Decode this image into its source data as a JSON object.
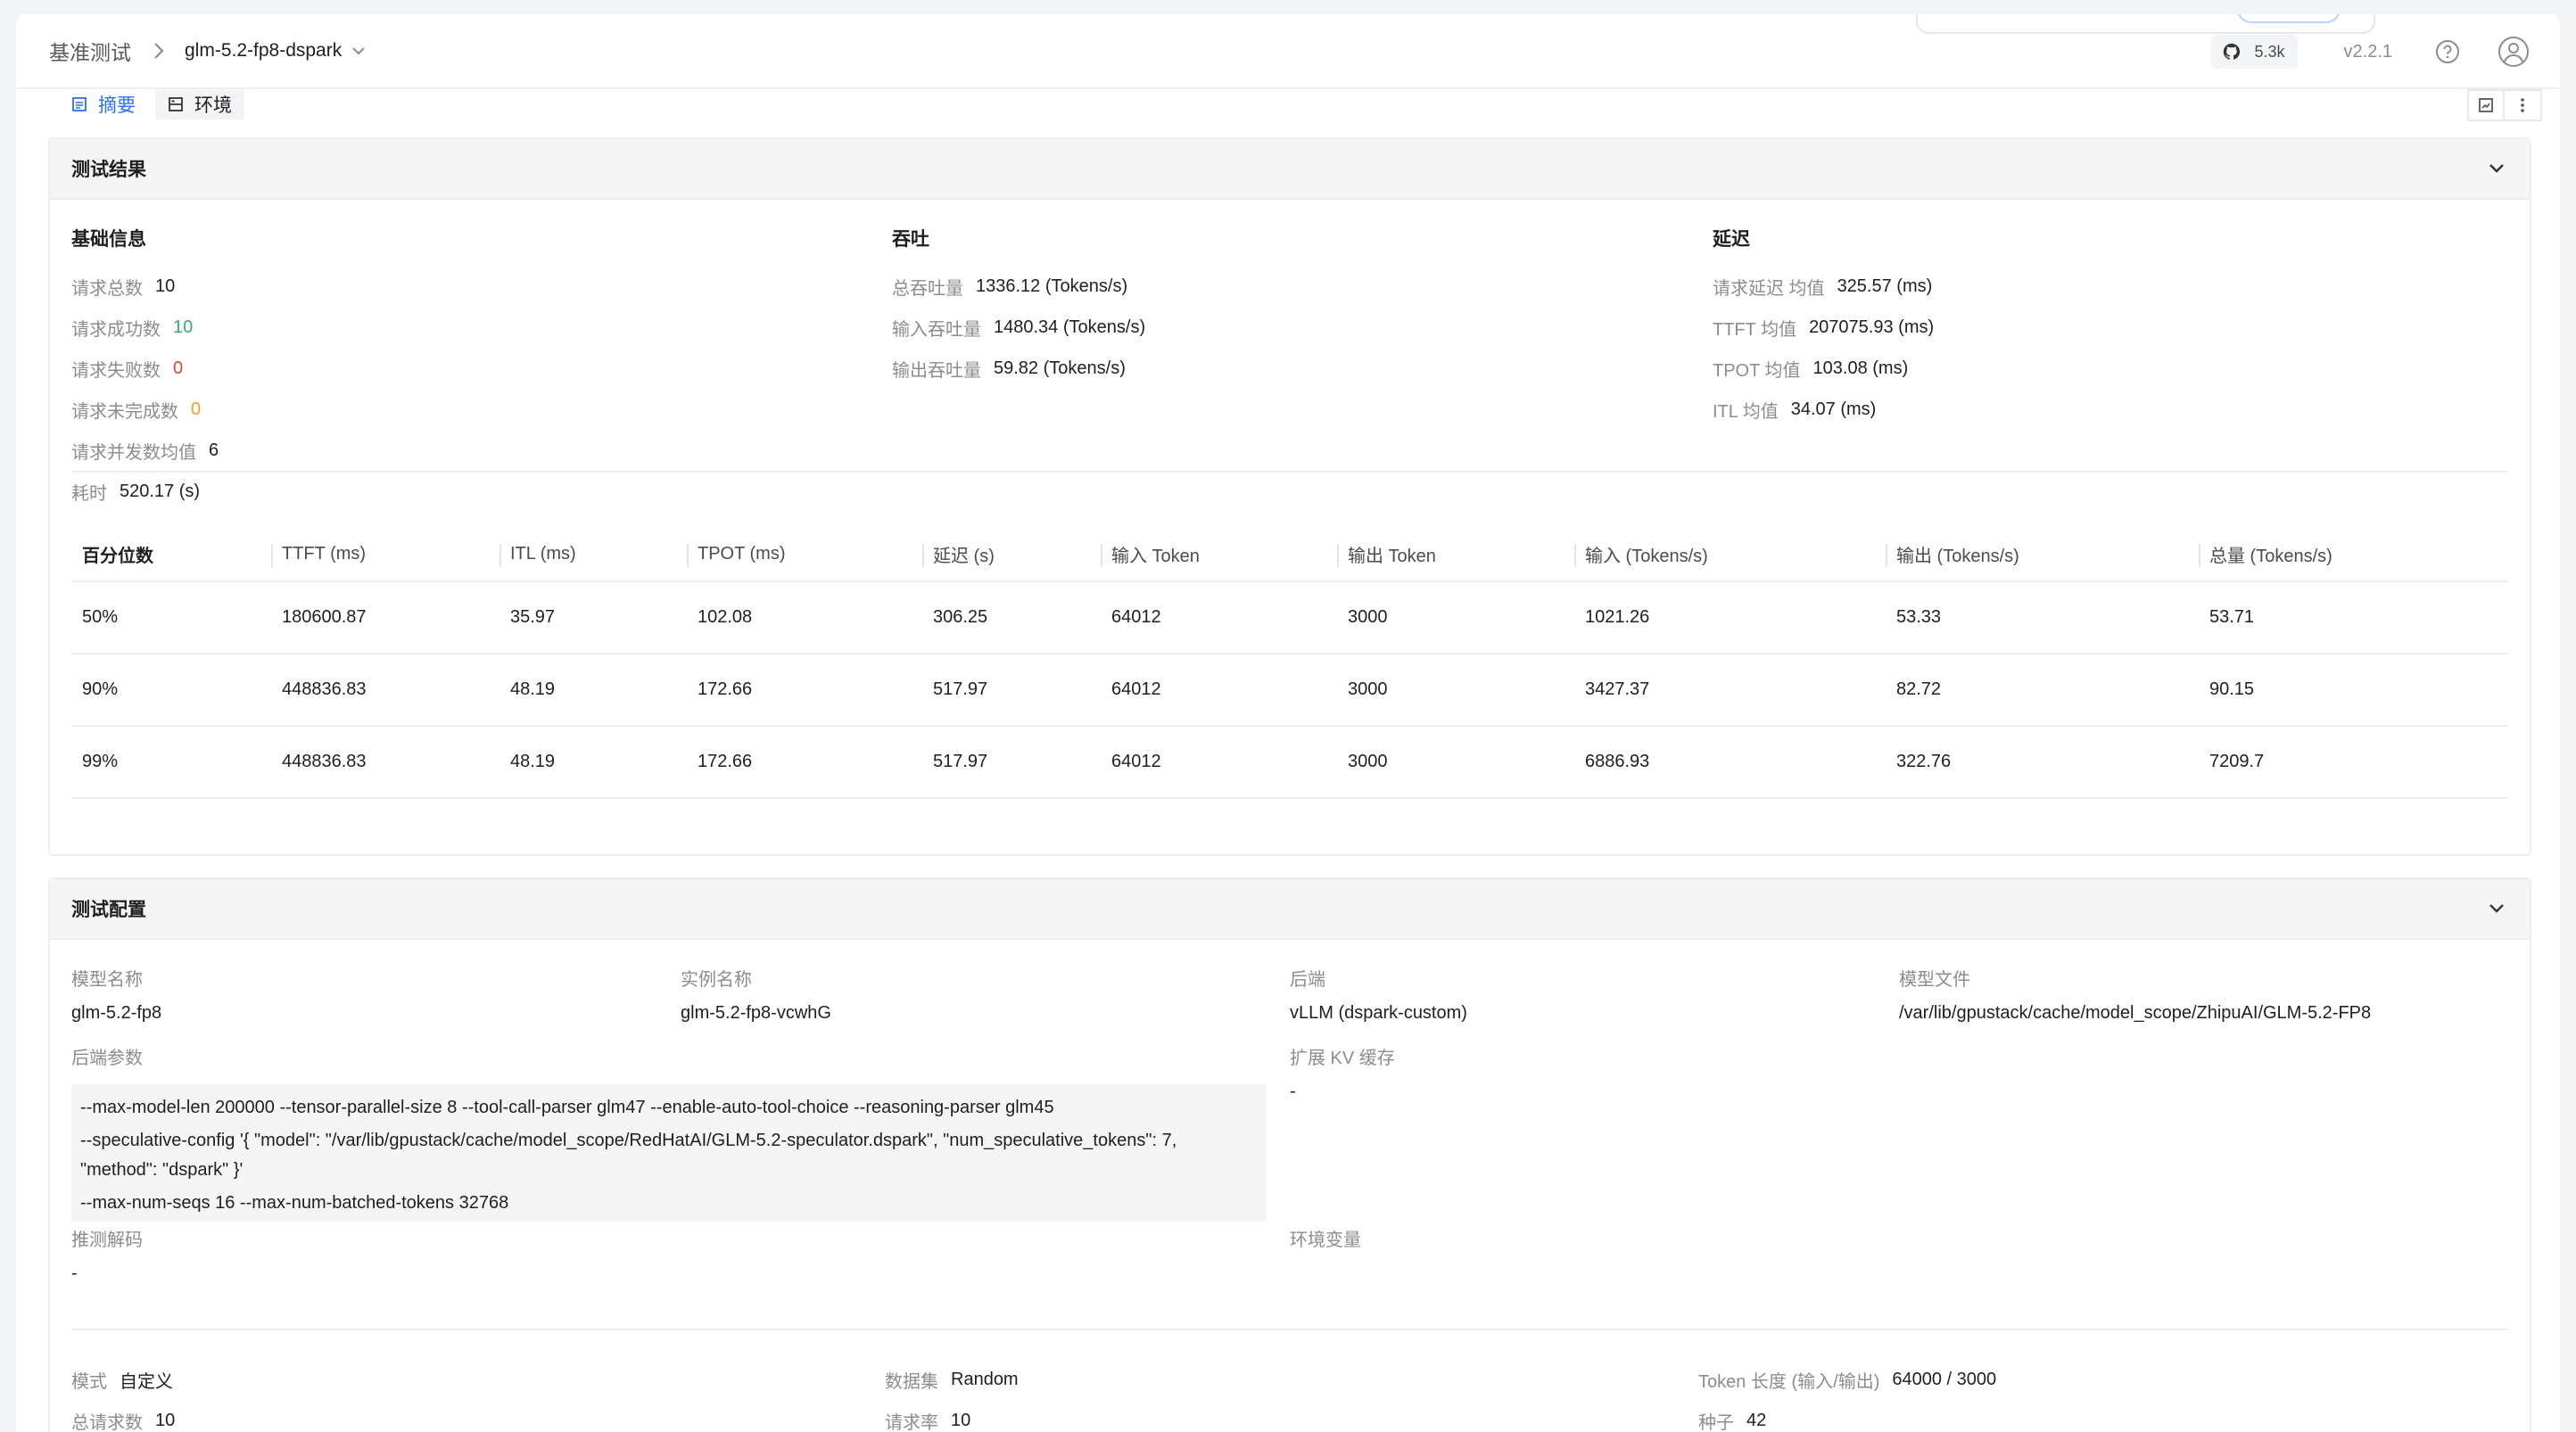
{
  "header": {
    "breadcrumb_root": "基准测试",
    "breadcrumb_current": "glm-5.2-fp8-dspark",
    "github_stars": "5.3k",
    "version": "v2.2.1"
  },
  "tabs": [
    {
      "label": "摘要",
      "active": true
    },
    {
      "label": "环境",
      "active": false
    }
  ],
  "results": {
    "title": "测试结果",
    "basic": {
      "title": "基础信息",
      "items": [
        {
          "label": "请求总数",
          "value": "10"
        },
        {
          "label": "请求成功数",
          "value": "10"
        },
        {
          "label": "请求失败数",
          "value": "0"
        },
        {
          "label": "请求未完成数",
          "value": "0"
        },
        {
          "label": "请求并发数均值",
          "value": "6"
        },
        {
          "label": "耗时",
          "value": "520.17 (s)"
        }
      ]
    },
    "throughput": {
      "title": "吞吐",
      "items": [
        {
          "label": "总吞吐量",
          "value": "1336.12 (Tokens/s)"
        },
        {
          "label": "输入吞吐量",
          "value": "1480.34 (Tokens/s)"
        },
        {
          "label": "输出吞吐量",
          "value": "59.82 (Tokens/s)"
        }
      ]
    },
    "latency": {
      "title": "延迟",
      "items": [
        {
          "label": "请求延迟 均值",
          "value": "325.57 (ms)"
        },
        {
          "label": "TTFT 均值",
          "value": "207075.93 (ms)"
        },
        {
          "label": "TPOT 均值",
          "value": "103.08 (ms)"
        },
        {
          "label": "ITL 均值",
          "value": "34.07 (ms)"
        }
      ]
    },
    "table": {
      "headers": [
        "百分位数",
        "TTFT (ms)",
        "ITL (ms)",
        "TPOT (ms)",
        "延迟 (s)",
        "输入 Token",
        "输出 Token",
        "输入 (Tokens/s)",
        "输出 (Tokens/s)",
        "总量 (Tokens/s)"
      ],
      "rows": [
        [
          "50%",
          "180600.87",
          "35.97",
          "102.08",
          "306.25",
          "64012",
          "3000",
          "1021.26",
          "53.33",
          "53.71"
        ],
        [
          "90%",
          "448836.83",
          "48.19",
          "172.66",
          "517.97",
          "64012",
          "3000",
          "3427.37",
          "82.72",
          "90.15"
        ],
        [
          "99%",
          "448836.83",
          "48.19",
          "172.66",
          "517.97",
          "64012",
          "3000",
          "6886.93",
          "322.76",
          "7209.7"
        ]
      ]
    }
  },
  "config": {
    "title": "测试配置",
    "model_name_label": "模型名称",
    "model_name": "glm-5.2-fp8",
    "instance_label": "实例名称",
    "instance": "glm-5.2-fp8-vcwhG",
    "backend_label": "后端",
    "backend": "vLLM (dspark-custom)",
    "model_file_label": "模型文件",
    "model_file": "/var/lib/gpustack/cache/model_scope/ZhipuAI/GLM-5.2-FP8",
    "backend_params_label": "后端参数",
    "backend_params": [
      "--max-model-len 200000  --tensor-parallel-size 8  --tool-call-parser glm47  --enable-auto-tool-choice  --reasoning-parser glm45",
      "--speculative-config '{ \"model\": \"/var/lib/gpustack/cache/model_scope/RedHatAI/GLM-5.2-speculator.dspark\", \"num_speculative_tokens\": 7,",
      "\"method\": \"dspark\" }'",
      "--max-num-seqs 16  --max-num-batched-tokens 32768"
    ],
    "kv_cache_label": "扩展 KV 缓存",
    "kv_cache": "-",
    "spec_decode_label": "推测解码",
    "spec_decode": "-",
    "env_vars_label": "环境变量",
    "mode_label": "模式",
    "mode": "自定义",
    "dataset_label": "数据集",
    "dataset": "Random",
    "token_len_label": "Token 长度 (输入/输出)",
    "token_len": "64000 / 3000",
    "total_requests_label": "总请求数",
    "total_requests": "10",
    "request_rate_label": "请求率",
    "request_rate": "10",
    "seed_label": "种子",
    "seed": "42"
  },
  "colors": {
    "accent": "#2f6fed",
    "success": "#2fb36a",
    "error": "#e8413a",
    "warning": "#f0a020"
  }
}
